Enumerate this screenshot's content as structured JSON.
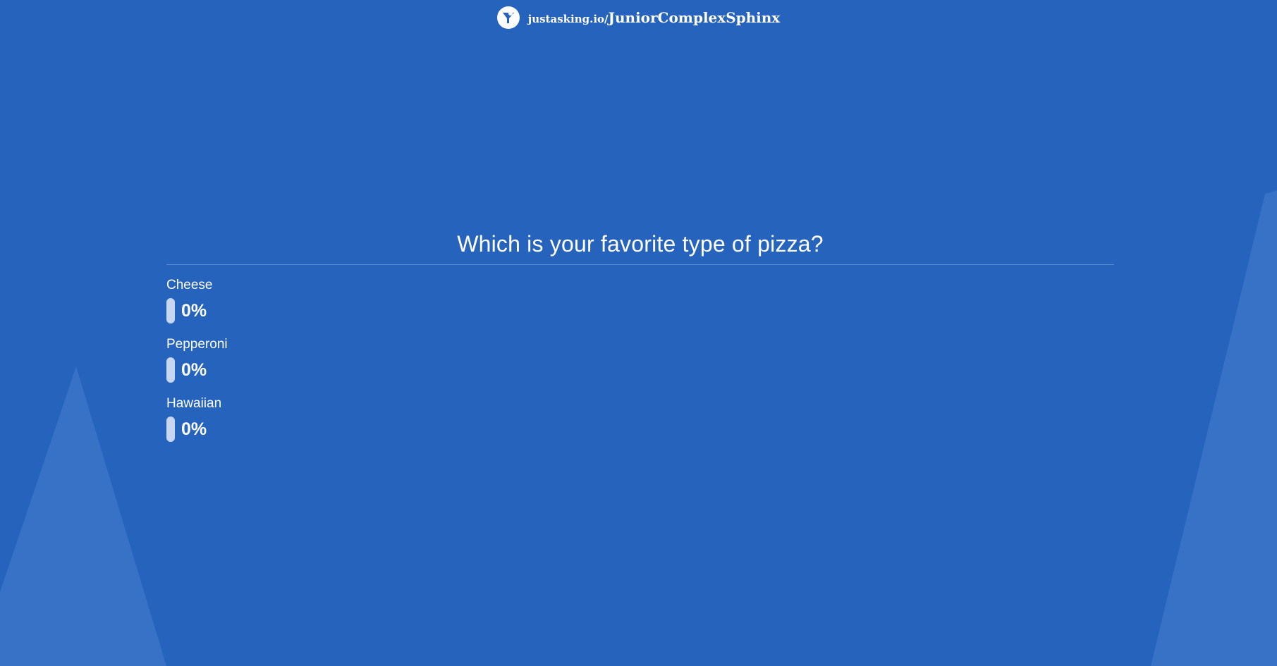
{
  "header": {
    "logo_icon": "justasking-logo-icon",
    "url_prefix": "justasking.io/",
    "url_slug": "JuniorComplexSphinx"
  },
  "poll": {
    "question": "Which is your favorite type of pizza?",
    "options": [
      {
        "label": "Cheese",
        "percent_text": "0%",
        "percent": 0
      },
      {
        "label": "Pepperoni",
        "percent_text": "0%",
        "percent": 0
      },
      {
        "label": "Hawaiian",
        "percent_text": "0%",
        "percent": 0
      }
    ]
  },
  "colors": {
    "background": "#2563bd",
    "bar": "#c8d7f1",
    "decorative_shape": "#3a73c7"
  }
}
